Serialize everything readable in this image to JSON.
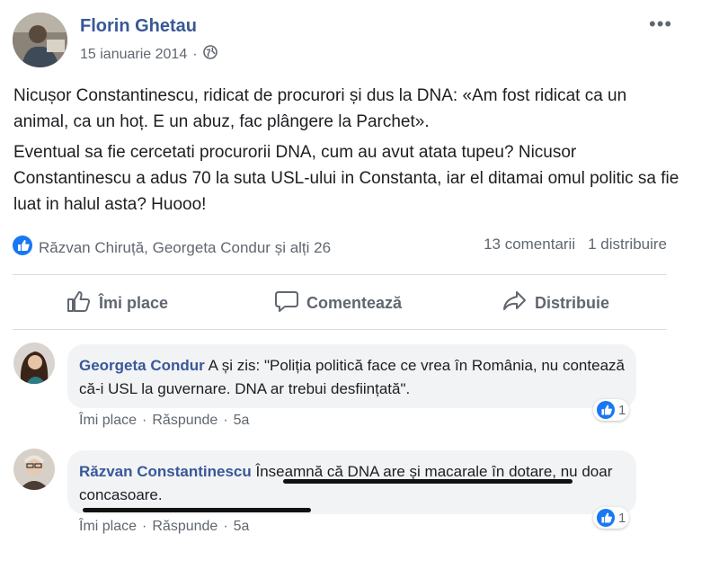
{
  "post": {
    "author": "Florin Ghetau",
    "date": "15 ianuarie 2014",
    "separator": "·",
    "privacy_icon": "globe-icon",
    "more_icon": "more-options-icon",
    "more_glyph": "•••",
    "paragraph1": "Nicușor Constantinescu, ridicat de procurori și dus la DNA: «Am fost ridicat ca un animal, ca un hoț. E un abuz, fac plângere la Parchet».",
    "paragraph2": "Eventual sa fie cercetati procurorii DNA, cum au avut atata tupeu? Nicusor Constantinescu a adus 70 la suta USL-ului in Constanta, iar el ditamai omul politic sa fie luat in halul asta? Huooo!",
    "reactions_text": "Răzvan Chiruță, Georgeta Condur și alți 26",
    "comments_count": "13 comentarii",
    "shares_count": "1 distribuire",
    "colors": {
      "link": "#385898",
      "like_blue": "#1877f2",
      "secondary": "#606770",
      "bubble": "#f2f3f5"
    }
  },
  "actions": {
    "like": "Îmi place",
    "comment": "Comentează",
    "share": "Distribuie"
  },
  "comments": [
    {
      "author": "Georgeta Condur",
      "text": "A și zis: \"Poliția politică face ce vrea în România, nu contează că-i USL la guvernare. DNA ar trebui desființată\".",
      "like": "Îmi place",
      "reply": "Răspunde",
      "time": "5a",
      "dot": "·",
      "reactions": "1"
    },
    {
      "author": "Răzvan Constantinescu",
      "text": "Înseamnă că DNA are și macarale în dotare, nu doar concasoare.",
      "like": "Îmi place",
      "reply": "Răspunde",
      "time": "5a",
      "dot": "·",
      "reactions": "1"
    }
  ]
}
